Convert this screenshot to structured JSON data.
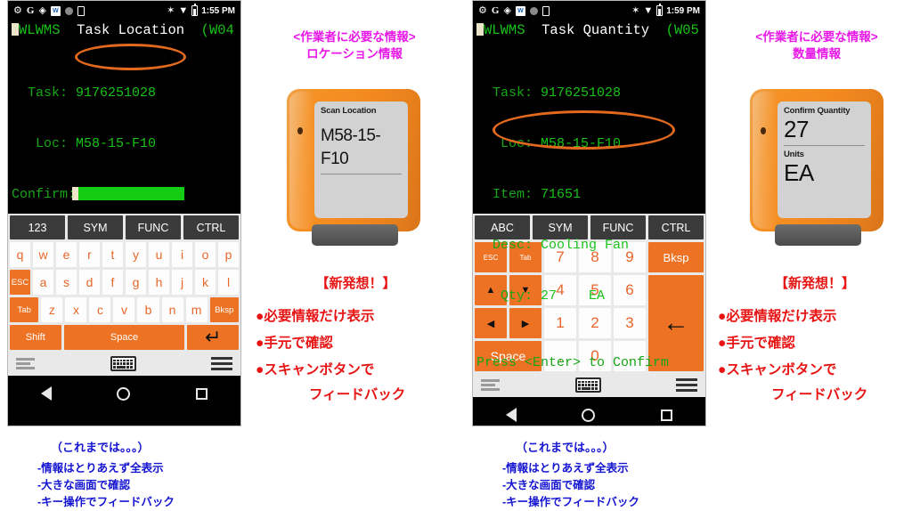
{
  "panels": [
    {
      "id": "location",
      "phone": {
        "status_bar": {
          "icons": [
            "gear-icon",
            "google-icon",
            "maps-pin-icon",
            "word-icon",
            "circle-icon",
            "sim-icon"
          ],
          "word_icon_text": "W",
          "right_icons": [
            "bluetooth-icon",
            "wifi-icon",
            "battery-icon"
          ],
          "bluetooth_glyph": "✶",
          "wifi_glyph": "▼",
          "time": "1:55 PM"
        },
        "terminal": {
          "app_name": "WLWMS",
          "title": "Task Location",
          "window_code": "(W04",
          "rows": [
            {
              "label": "  Task: ",
              "value": "9176251028"
            },
            {
              "label": "   Loc: ",
              "value": "M58-15-F10"
            },
            {
              "label": "Confirm:",
              "value": ""
            }
          ]
        },
        "keyboard": {
          "type": "alpha",
          "modifier_row": [
            "123",
            "SYM",
            "FUNC",
            "CTRL"
          ],
          "row1": [
            "q",
            "w",
            "e",
            "r",
            "t",
            "y",
            "u",
            "i",
            "o",
            "p"
          ],
          "row2": [
            "ESC",
            "a",
            "s",
            "d",
            "f",
            "g",
            "h",
            "j",
            "k",
            "l"
          ],
          "row3": [
            "Tab",
            "z",
            "x",
            "c",
            "v",
            "b",
            "n",
            "m",
            "Bksp"
          ],
          "row4": [
            "Shift",
            "Space",
            "↵"
          ]
        },
        "nav_bar": [
          "back-button",
          "home-button",
          "recents-button"
        ]
      },
      "annotation_top": [
        "<作業者に必要な情報>",
        "ロケーション情報"
      ],
      "device": {
        "screen_label": "Scan Location",
        "screen_value": "M58-15-F10"
      },
      "annotation_red": {
        "header": "【新発想！】",
        "items": [
          "●必要情報だけ表示",
          "●手元で確認",
          "●スキャンボタンで",
          "フィードバック"
        ]
      },
      "annotation_blue_title": "（これまでは。。。）",
      "annotation_blue": [
        "-情報はとりあえず全表示",
        "-大きな画面で確認",
        "-キー操作でフィードバック"
      ]
    },
    {
      "id": "quantity",
      "phone": {
        "status_bar": {
          "icons": [
            "gear-icon",
            "google-icon",
            "maps-pin-icon",
            "word-icon",
            "circle-icon",
            "sim-icon"
          ],
          "word_icon_text": "W",
          "right_icons": [
            "bluetooth-icon",
            "wifi-icon",
            "battery-icon"
          ],
          "bluetooth_glyph": "✶",
          "wifi_glyph": "▼",
          "time": "1:59 PM"
        },
        "terminal": {
          "app_name": "WLWMS",
          "title": "Task Quantity",
          "window_code": "(W05",
          "rows": [
            {
              "label": "  Task: ",
              "value": "9176251028"
            },
            {
              "label": "   Loc: ",
              "value": "M58-15-F10"
            },
            {
              "label": "  Item: ",
              "value": "71651"
            },
            {
              "label": "  Desc: ",
              "value": "Cooling Fan"
            },
            {
              "label": "   Qty: ",
              "value": "27    EA"
            }
          ],
          "prompt": "Press <Enter> to Confirm"
        },
        "keyboard": {
          "type": "numeric",
          "modifier_row": [
            "ABC",
            "SYM",
            "FUNC",
            "CTRL"
          ],
          "left_col": [
            "ESC",
            "Tab",
            "▲",
            "▼",
            "◀",
            "▶",
            "Space"
          ],
          "numbers": [
            "7",
            "8",
            "9",
            "4",
            "5",
            "6",
            "1",
            "2",
            "3",
            ",",
            "0",
            "."
          ],
          "right_col": [
            "Bksp",
            "←"
          ]
        },
        "nav_bar": [
          "back-button",
          "home-button",
          "recents-button"
        ]
      },
      "annotation_top": [
        "<作業者に必要な情報>",
        "数量情報"
      ],
      "device": {
        "screen_label": "Confirm Quantity",
        "screen_value": "27",
        "screen_label2": "Units",
        "screen_value2": "EA"
      },
      "annotation_red": {
        "header": "【新発想！】",
        "items": [
          "●必要情報だけ表示",
          "●手元で確認",
          "●スキャンボタンで",
          "フィードバック"
        ]
      },
      "annotation_blue_title": "（これまでは。。。）",
      "annotation_blue": [
        "-情報はとりあえず全表示",
        "-大きな画面で確認",
        "-キー操作でフィードバック"
      ]
    }
  ],
  "colors": {
    "terminal_green": "#19c219",
    "key_orange": "#ee7223",
    "highlight_ellipse": "#e2691e",
    "annotation_magenta": "#e818e8",
    "annotation_red": "#e81414",
    "annotation_blue": "#1414d2",
    "device_orange": "#f2891f"
  }
}
